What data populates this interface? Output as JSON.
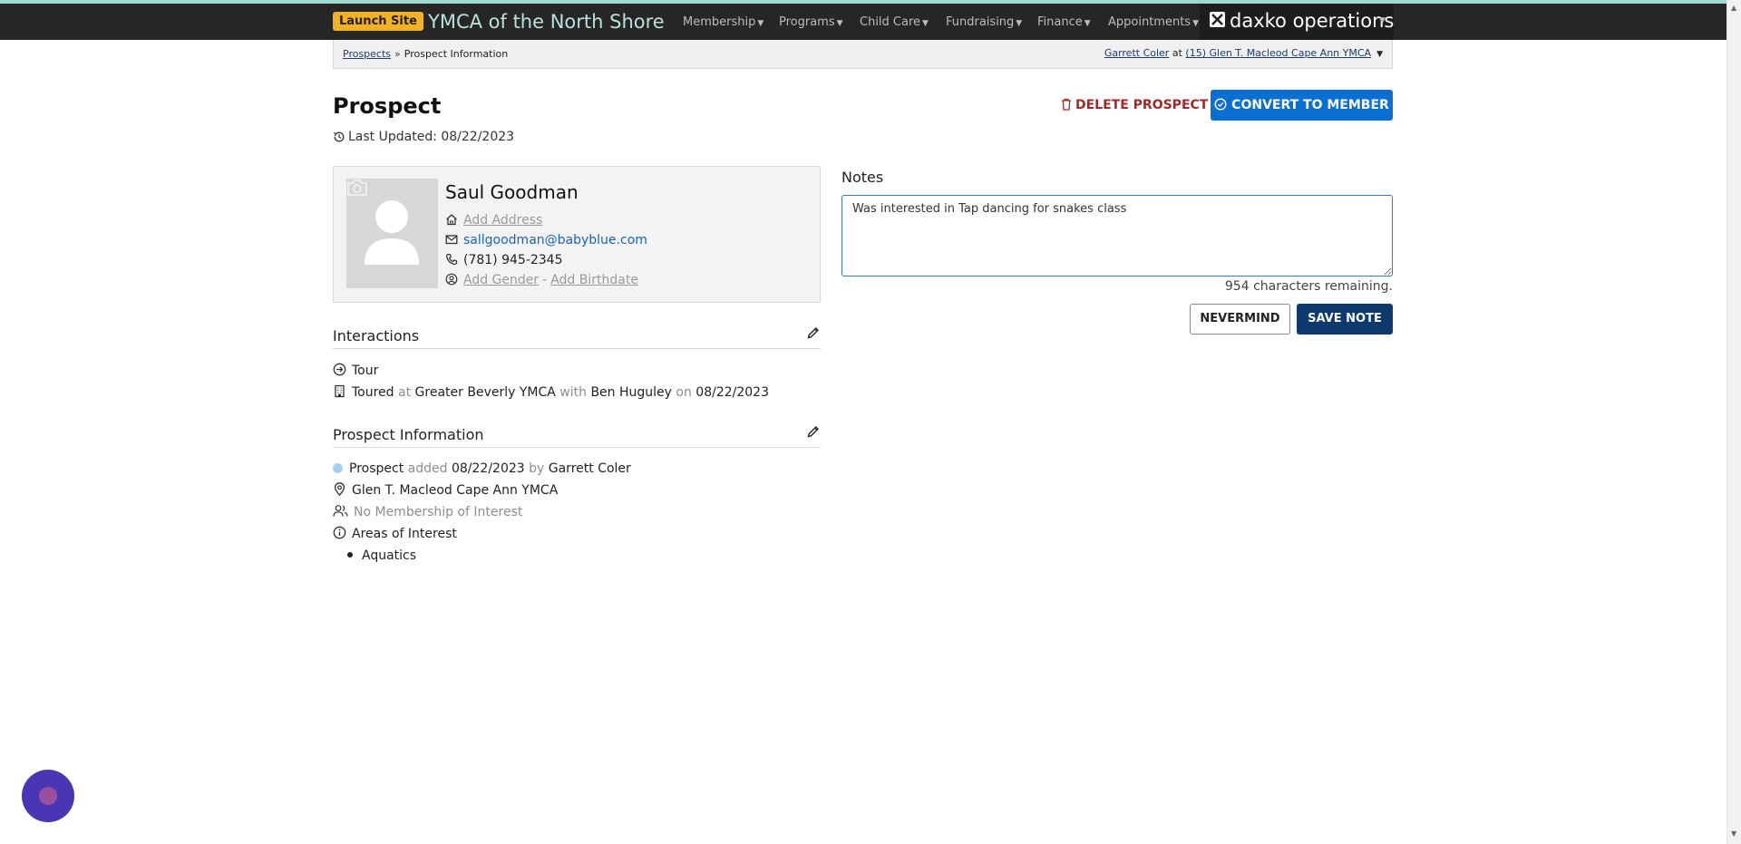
{
  "topnav": {
    "launch_label": "Launch Site",
    "org_name": "YMCA of the North Shore",
    "menus": [
      "Membership",
      "Programs",
      "Child Care",
      "Fundraising",
      "Finance",
      "Appointments"
    ],
    "brand": "daxko operations"
  },
  "breadcrumb": {
    "parent": "Prospects",
    "separator": "»",
    "current": "Prospect Information"
  },
  "user_context": {
    "user": "Garrett Coler",
    "joiner": "at",
    "location": "(15) Glen T. Macleod Cape Ann YMCA"
  },
  "header": {
    "title": "Prospect",
    "last_updated": "Last Updated: 08/22/2023",
    "delete_label": "DELETE PROSPECT",
    "convert_label": "CONVERT TO MEMBER"
  },
  "profile": {
    "name": "Saul Goodman",
    "address_placeholder": "Add Address",
    "email": "sallgoodman@babyblue.com",
    "phone": "(781) 945-2345",
    "gender_placeholder": "Add Gender",
    "separator": "-",
    "birthdate_placeholder": "Add Birthdate"
  },
  "interactions": {
    "title": "Interactions",
    "type": "Tour",
    "detail": {
      "action": "Toured",
      "at": "at",
      "location": "Greater Beverly YMCA",
      "with": "with",
      "staff": "Ben Huguley",
      "on": "on",
      "date": "08/22/2023"
    }
  },
  "prospect_info": {
    "title": "Prospect Information",
    "status": "Prospect",
    "added_word": "added",
    "added_date": "08/22/2023",
    "by_word": "by",
    "added_by": "Garrett Coler",
    "branch": "Glen T. Macleod Cape Ann YMCA",
    "membership": "No Membership of Interest",
    "areas_label": "Areas of Interest",
    "areas": [
      "Aquatics"
    ]
  },
  "notes": {
    "label": "Notes",
    "value": "Was interested in Tap dancing for snakes class",
    "remaining": "954 characters remaining.",
    "cancel_label": "NEVERMIND",
    "save_label": "SAVE NOTE"
  },
  "colors": {
    "nav_bg": "#262626",
    "accent_blue": "#0b6fd1",
    "save_blue": "#0c3a6c",
    "delete_red": "#a32828",
    "launch_yellow": "#f3b223",
    "prospect_dot": "#a6cff0"
  }
}
